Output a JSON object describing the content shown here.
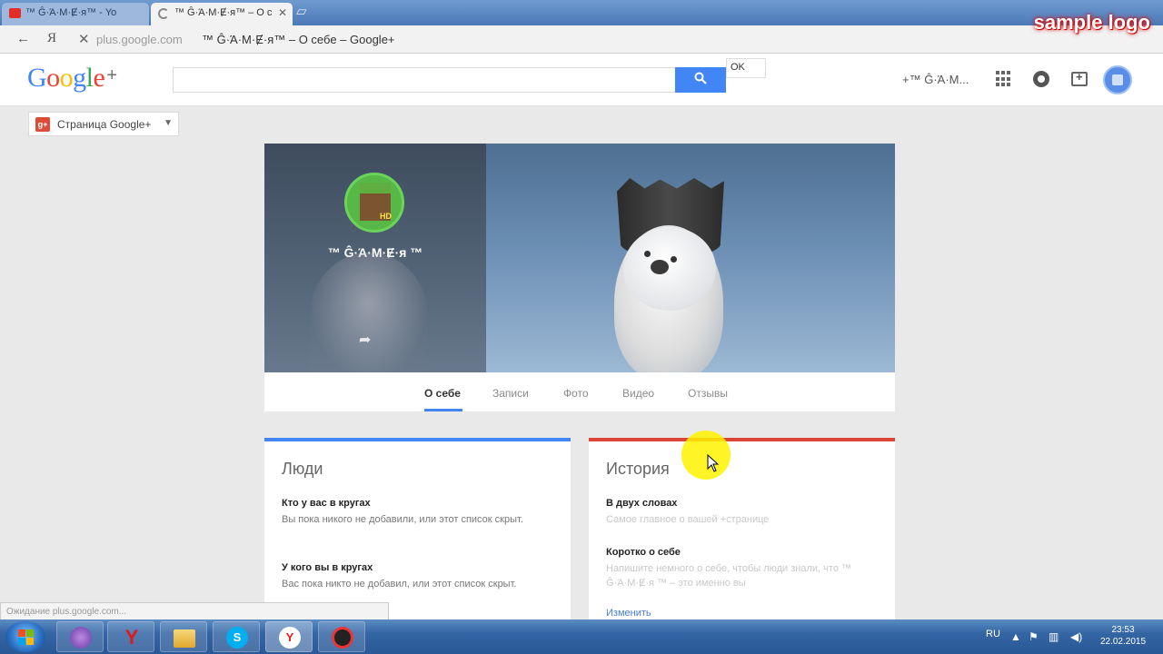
{
  "browser": {
    "tabs": [
      {
        "label": "™ Ĝ·Ά·M·Ɇ·я™ - Yo"
      },
      {
        "label": "™ Ĝ·Ά·M·Ɇ·я™ – О с"
      }
    ],
    "url_host": "plus.google.com",
    "page_title": "™ Ĝ·Ά·M·Ɇ·я™ – О себе – Google+",
    "watermark": "sample logo"
  },
  "header": {
    "logo_letters": [
      "G",
      "o",
      "o",
      "g",
      "l",
      "e"
    ],
    "logo_plus": "+",
    "search_placeholder": "",
    "ok_popup": "OK",
    "user_name": "+™ Ĝ·Ά·M..."
  },
  "page_switch": {
    "label": "Страница Google+"
  },
  "profile": {
    "name": "™ Ĝ·Ά·M·Ɇ·я ™",
    "avatar_badge": "HD"
  },
  "profile_tabs": [
    "О себе",
    "Записи",
    "Фото",
    "Видео",
    "Отзывы"
  ],
  "cards": {
    "people": {
      "title": "Люди",
      "s1_title": "Кто у вас в кругах",
      "s1_text": "Вы пока никого не добавили, или этот список скрыт.",
      "s2_title": "У кого вы в кругах",
      "s2_text": "Вас пока никто не добавил, или этот список скрыт."
    },
    "story": {
      "title": "История",
      "s1_title": "В двух словах",
      "s1_text": "Самое главное о вашей +странице",
      "s2_title": "Коротко о себе",
      "s2_text": "Напишите немного о себе, чтобы люди знали, что ™ Ĝ·Ά·M·Ɇ·я ™ – это именно вы",
      "edit": "Изменить"
    }
  },
  "status": "Ожидание plus.google.com...",
  "taskbar": {
    "lang": "RU",
    "time": "23:53",
    "date": "22.02.2015"
  },
  "colors": {
    "accent_blue": "#4285f4",
    "accent_red": "#db4437",
    "highlight": "#fff200"
  }
}
